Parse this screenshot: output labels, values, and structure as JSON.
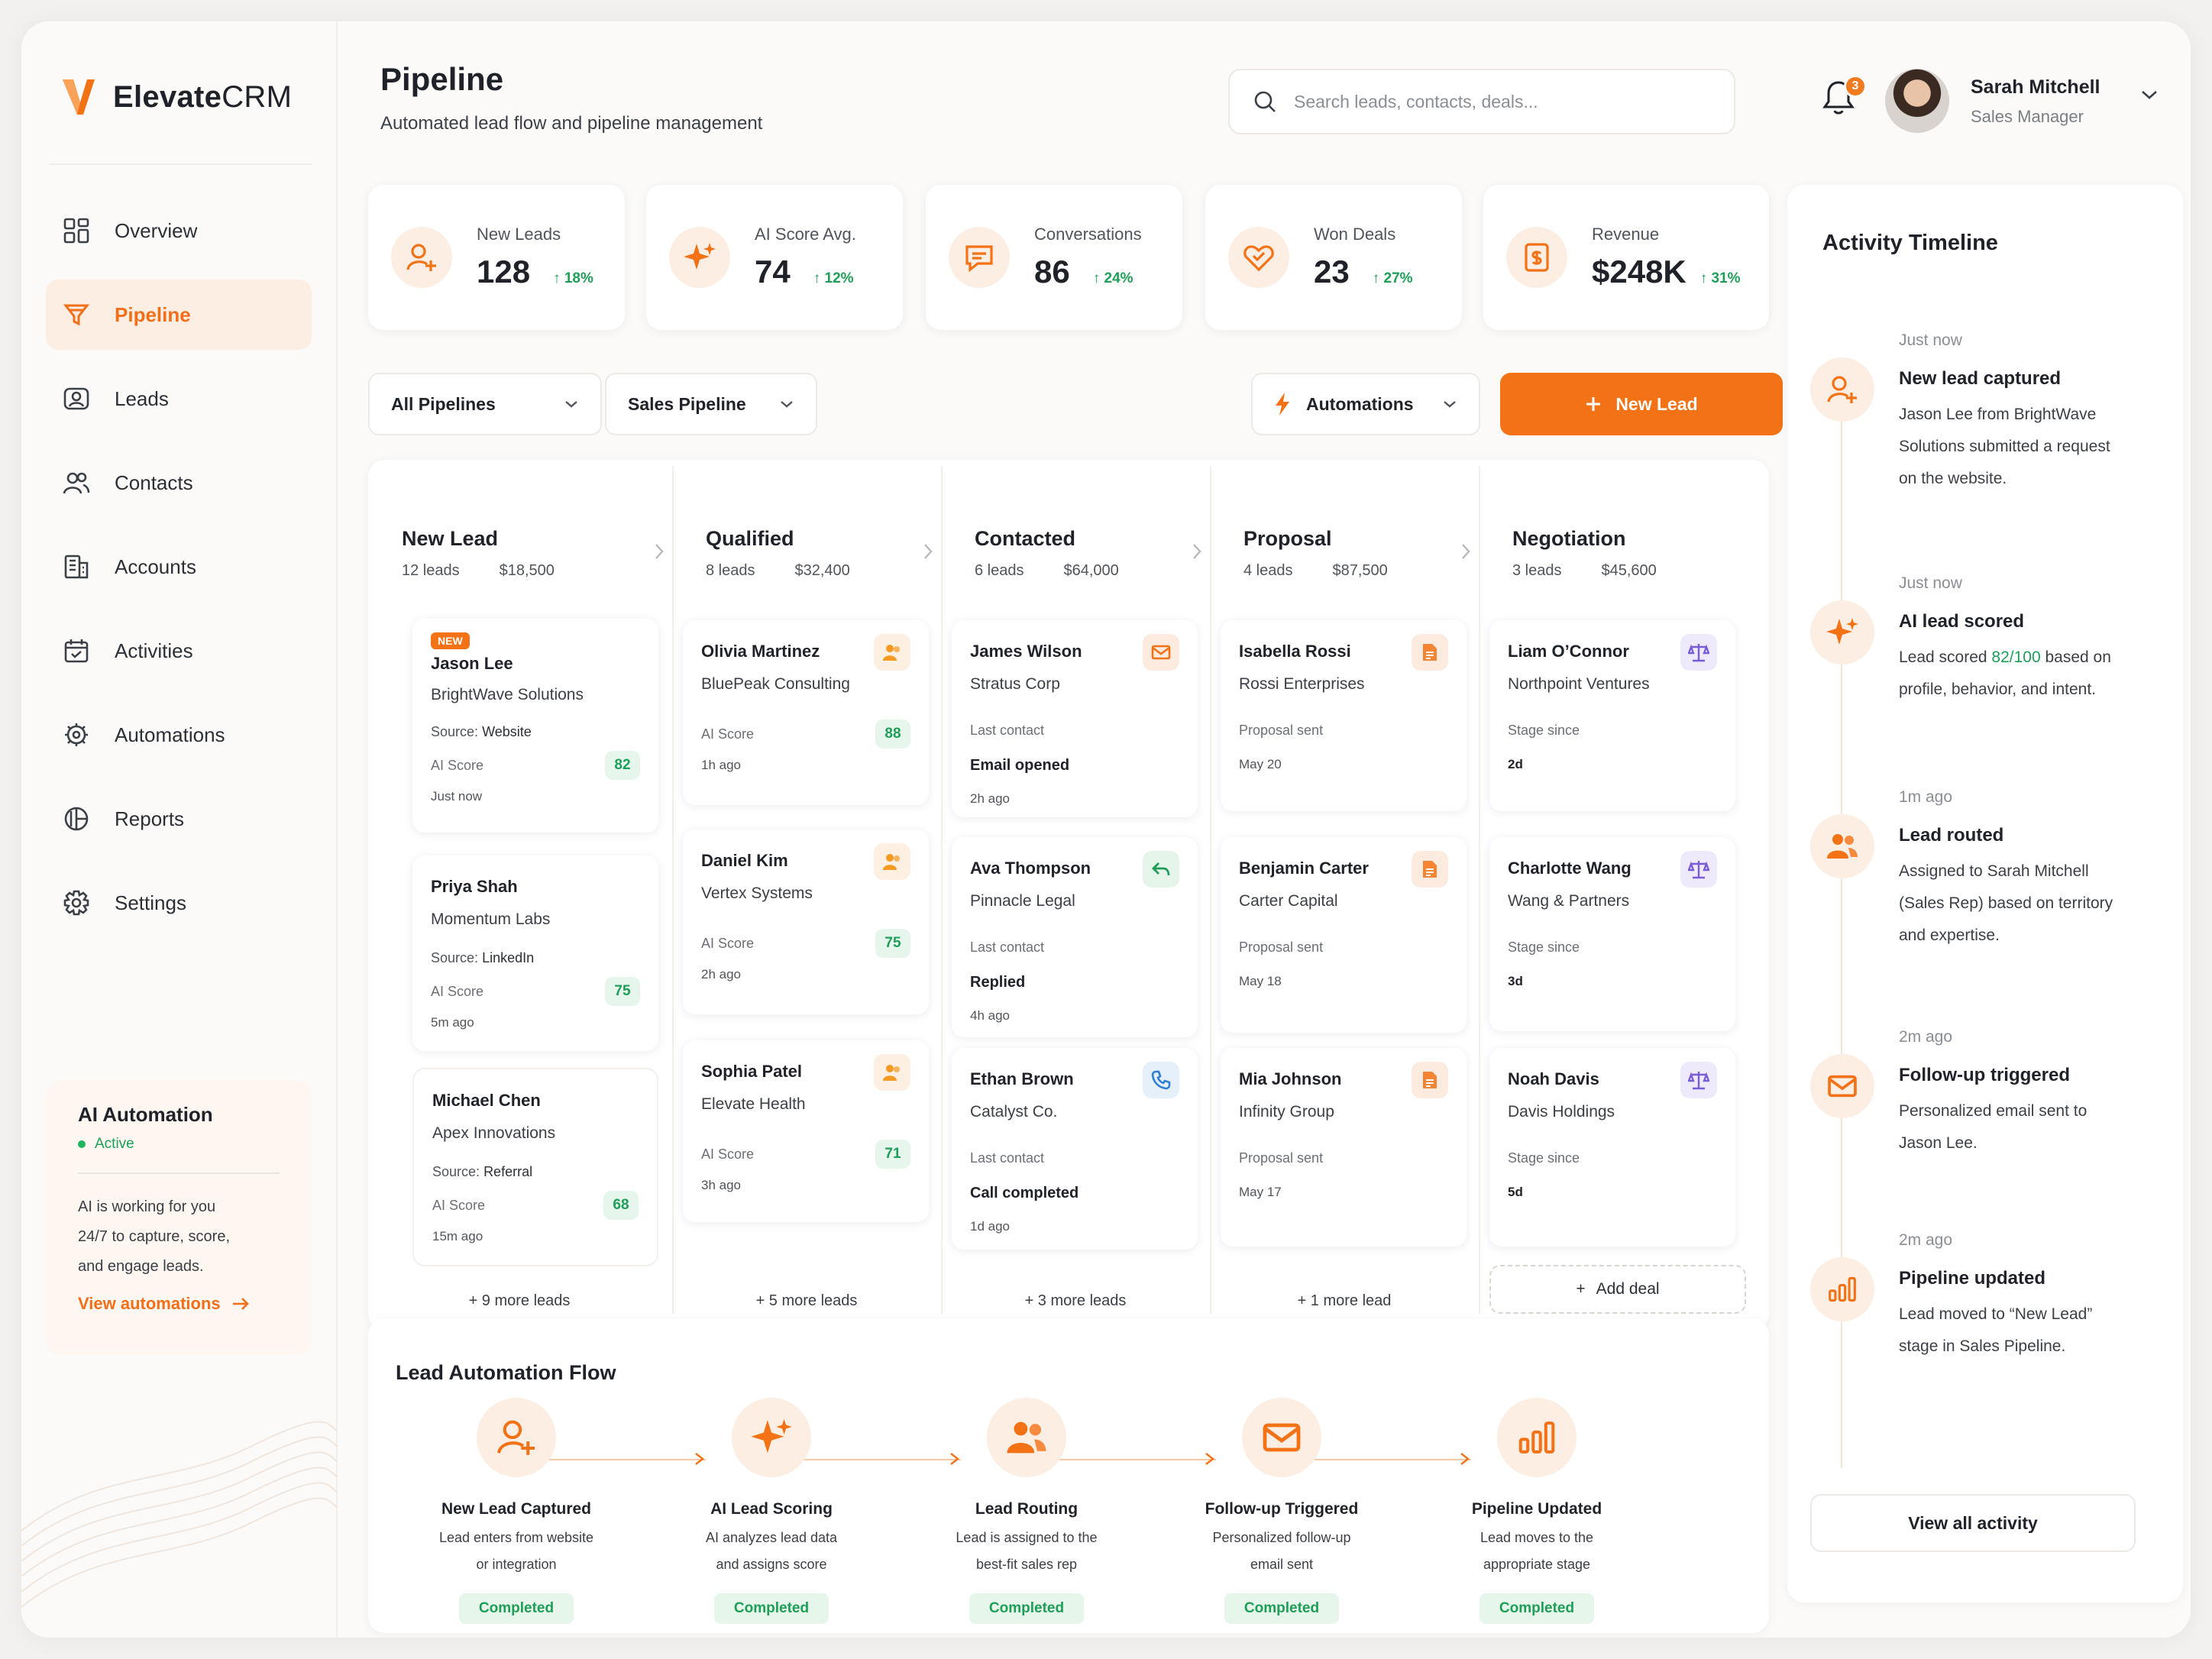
{
  "brand": {
    "name_part1": "Elevate",
    "name_part2": "CRM",
    "accent": "#f47216"
  },
  "sidebar": {
    "items": [
      {
        "label": "Overview",
        "icon": "grid-icon"
      },
      {
        "label": "Pipeline",
        "icon": "funnel-icon",
        "active": true
      },
      {
        "label": "Leads",
        "icon": "user-card-icon"
      },
      {
        "label": "Contacts",
        "icon": "users-icon"
      },
      {
        "label": "Accounts",
        "icon": "building-icon"
      },
      {
        "label": "Activities",
        "icon": "calendar-icon"
      },
      {
        "label": "Automations",
        "icon": "cog-sparkle-icon"
      },
      {
        "label": "Reports",
        "icon": "pie-chart-icon"
      },
      {
        "label": "Settings",
        "icon": "gear-icon"
      }
    ],
    "ai_box": {
      "title": "AI Automation",
      "status": "Active",
      "text_lines": [
        "AI is working for you",
        "24/7 to capture, score,",
        "and engage leads."
      ],
      "link": "View automations"
    }
  },
  "header": {
    "title": "Pipeline",
    "subtitle": "Automated lead flow and pipeline management",
    "search_placeholder": "Search leads, contacts, deals...",
    "notifications": "3",
    "user": {
      "name": "Sarah Mitchell",
      "role": "Sales Manager"
    }
  },
  "stats": [
    {
      "label": "New Leads",
      "value": "128",
      "change": "18%",
      "icon": "user-plus-icon"
    },
    {
      "label": "AI Score Avg.",
      "value": "74",
      "change": "12%",
      "icon": "sparkle-icon"
    },
    {
      "label": "Conversations",
      "value": "86",
      "change": "24%",
      "icon": "chat-icon"
    },
    {
      "label": "Won Deals",
      "value": "23",
      "change": "27%",
      "icon": "handshake-icon"
    },
    {
      "label": "Revenue",
      "value": "$248K",
      "change": "31%",
      "icon": "invoice-icon"
    }
  ],
  "controls": {
    "pipeline_filter": "All Pipelines",
    "pipeline_select": "Sales Pipeline",
    "automations": "Automations",
    "new_lead": "New Lead"
  },
  "pipeline": {
    "columns": [
      {
        "name": "New Lead",
        "count": "12 leads",
        "amount": "$18,500",
        "more": "+ 9 more leads",
        "cards": [
          {
            "badge": "NEW",
            "name": "Jason Lee",
            "company": "BrightWave Solutions",
            "source_label": "Source:",
            "source": "Website",
            "score_label": "AI Score",
            "score": "82",
            "time": "Just now"
          },
          {
            "name": "Priya Shah",
            "company": "Momentum Labs",
            "source_label": "Source:",
            "source": "LinkedIn",
            "score_label": "AI Score",
            "score": "75",
            "time": "5m ago"
          },
          {
            "name": "Michael Chen",
            "company": "Apex Innovations",
            "source_label": "Source:",
            "source": "Referral",
            "score_label": "AI Score",
            "score": "68",
            "time": "15m ago"
          }
        ]
      },
      {
        "name": "Qualified",
        "count": "8 leads",
        "amount": "$32,400",
        "more": "+ 5 more leads",
        "cards": [
          {
            "name": "Olivia Martinez",
            "company": "BluePeak Consulting",
            "score_label": "AI Score",
            "score": "88",
            "time": "1h ago",
            "icon": "people-icon"
          },
          {
            "name": "Daniel Kim",
            "company": "Vertex Systems",
            "score_label": "AI Score",
            "score": "75",
            "time": "2h ago",
            "icon": "people-icon"
          },
          {
            "name": "Sophia Patel",
            "company": "Elevate Health",
            "score_label": "AI Score",
            "score": "71",
            "time": "3h ago",
            "icon": "people-icon"
          }
        ]
      },
      {
        "name": "Contacted",
        "count": "6 leads",
        "amount": "$64,000",
        "more": "+ 3 more leads",
        "cards": [
          {
            "name": "James Wilson",
            "company": "Stratus Corp",
            "label": "Last contact",
            "value": "Email opened",
            "time": "2h ago",
            "icon": "mail-icon"
          },
          {
            "name": "Ava Thompson",
            "company": "Pinnacle Legal",
            "label": "Last contact",
            "value": "Replied",
            "time": "4h ago",
            "icon": "reply-icon"
          },
          {
            "name": "Ethan Brown",
            "company": "Catalyst Co.",
            "label": "Last contact",
            "value": "Call completed",
            "time": "1d ago",
            "icon": "phone-icon"
          }
        ]
      },
      {
        "name": "Proposal",
        "count": "4 leads",
        "amount": "$87,500",
        "more": "+ 1 more lead",
        "cards": [
          {
            "name": "Isabella Rossi",
            "company": "Rossi Enterprises",
            "label": "Proposal sent",
            "value": "May 20",
            "icon": "document-icon"
          },
          {
            "name": "Benjamin Carter",
            "company": "Carter Capital",
            "label": "Proposal sent",
            "value": "May 18",
            "icon": "document-icon"
          },
          {
            "name": "Mia Johnson",
            "company": "Infinity Group",
            "label": "Proposal sent",
            "value": "May 17",
            "icon": "document-icon"
          }
        ]
      },
      {
        "name": "Negotiation",
        "count": "3 leads",
        "amount": "$45,600",
        "add": "Add deal",
        "cards": [
          {
            "name": "Liam O’Connor",
            "company": "Northpoint Ventures",
            "label": "Stage since",
            "value": "2d",
            "icon": "scale-icon"
          },
          {
            "name": "Charlotte Wang",
            "company": "Wang & Partners",
            "label": "Stage since",
            "value": "3d",
            "icon": "scale-icon"
          },
          {
            "name": "Noah Davis",
            "company": "Davis Holdings",
            "label": "Stage since",
            "value": "5d",
            "icon": "scale-icon"
          }
        ]
      }
    ]
  },
  "flow": {
    "title": "Lead Automation Flow",
    "steps": [
      {
        "title": "New Lead Captured",
        "l1": "Lead enters from website",
        "l2": "or integration",
        "status": "Completed",
        "icon": "user-plus-icon"
      },
      {
        "title": "AI Lead Scoring",
        "l1": "AI analyzes lead data",
        "l2": "and assigns score",
        "status": "Completed",
        "icon": "sparkle-icon"
      },
      {
        "title": "Lead Routing",
        "l1": "Lead is assigned to the",
        "l2": "best-fit sales rep",
        "status": "Completed",
        "icon": "users-icon"
      },
      {
        "title": "Follow-up Triggered",
        "l1": "Personalized follow-up",
        "l2": "email sent",
        "status": "Completed",
        "icon": "mail-icon"
      },
      {
        "title": "Pipeline Updated",
        "l1": "Lead moves to the",
        "l2": "appropriate stage",
        "status": "Completed",
        "icon": "bar-chart-icon"
      }
    ]
  },
  "timeline": {
    "title": "Activity Timeline",
    "button": "View all activity",
    "items": [
      {
        "time": "Just now",
        "title": "New lead captured",
        "lines": [
          "Jason Lee from BrightWave",
          "Solutions submitted a request",
          "on the website."
        ],
        "icon": "user-plus-icon"
      },
      {
        "time": "Just now",
        "title": "AI lead scored",
        "pre": "Lead scored ",
        "score": "82/100",
        "post": " based on",
        "lines": [
          "profile, behavior, and intent."
        ],
        "icon": "sparkle-icon"
      },
      {
        "time": "1m ago",
        "title": "Lead routed",
        "lines": [
          "Assigned to Sarah Mitchell",
          "(Sales Rep) based on territory",
          "and expertise."
        ],
        "icon": "users-icon"
      },
      {
        "time": "2m ago",
        "title": "Follow-up triggered",
        "lines": [
          "Personalized email sent to",
          "Jason Lee."
        ],
        "icon": "mail-icon"
      },
      {
        "time": "2m ago",
        "title": "Pipeline updated",
        "lines": [
          "Lead moved to “New Lead”",
          "stage in Sales Pipeline."
        ],
        "icon": "bar-chart-icon"
      }
    ]
  }
}
